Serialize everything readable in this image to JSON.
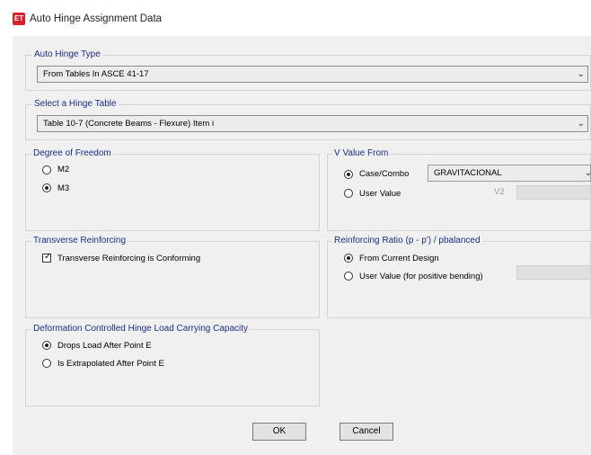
{
  "window": {
    "app_icon_text": "ET",
    "title": "Auto Hinge Assignment Data"
  },
  "auto_hinge_type": {
    "title": "Auto Hinge Type",
    "selected": "From Tables In ASCE 41-17"
  },
  "hinge_table": {
    "title": "Select a Hinge Table",
    "selected": "Table 10-7 (Concrete Beams - Flexure) Item i"
  },
  "dof": {
    "title": "Degree of Freedom",
    "options": [
      "M2",
      "M3"
    ],
    "selected": "M3"
  },
  "v_value": {
    "title": "V Value From",
    "case_combo_label": "Case/Combo",
    "user_value_label": "User Value",
    "selected": "Case/Combo",
    "case_combo_value": "GRAVITACIONAL",
    "v2_label": "V2",
    "v2_value": ""
  },
  "transverse": {
    "title": "Transverse Reinforcing",
    "checkbox_label": "Transverse Reinforcing is Conforming",
    "checked": true
  },
  "reinforcing_ratio": {
    "title": "Reinforcing Ratio  (p - p') / pbalanced",
    "options": [
      "From Current Design",
      "User Value (for positive bending)"
    ],
    "selected": "From Current Design",
    "user_value": ""
  },
  "deformation": {
    "title": "Deformation Controlled Hinge Load Carrying Capacity",
    "options": [
      "Drops Load After Point E",
      "Is Extrapolated After Point E"
    ],
    "selected": "Drops Load After Point E"
  },
  "buttons": {
    "ok": "OK",
    "cancel": "Cancel"
  },
  "icons": {
    "dropdown": "chevron-down-icon",
    "checkmark": "checkmark-icon"
  }
}
